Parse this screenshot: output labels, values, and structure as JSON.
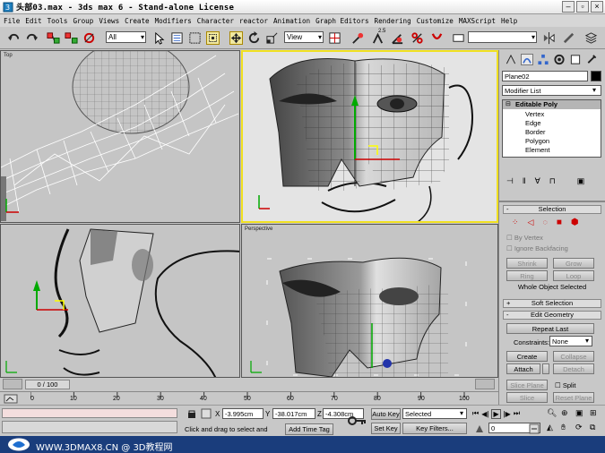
{
  "window": {
    "title": "头部03.max - 3ds max 6 - Stand-alone License"
  },
  "menu": [
    "File",
    "Edit",
    "Tools",
    "Group",
    "Views",
    "Create",
    "Modifiers",
    "Character",
    "reactor",
    "Animation",
    "Graph Editors",
    "Rendering",
    "Customize",
    "MAXScript",
    "Help"
  ],
  "toolbar": {
    "selection_filter": "All",
    "reference_coord": "View",
    "superscript": "2.5"
  },
  "viewports": {
    "top_label": "Top",
    "perspective_label": "Perspective"
  },
  "panel": {
    "object_name": "Plane02",
    "modifier_list": "Modifier List",
    "stack_root": "Editable Poly",
    "stack_items": [
      "Vertex",
      "Edge",
      "Border",
      "Polygon",
      "Element"
    ],
    "selection_title": "Selection",
    "by_vertex": "By Vertex",
    "ignore_backfacing": "Ignore Backfacing",
    "shrink": "Shrink",
    "grow": "Grow",
    "ring": "Ring",
    "loop": "Loop",
    "whole_object": "Whole Object Selected",
    "soft_selection": "Soft Selection",
    "edit_geometry": "Edit Geometry",
    "repeat_last": "Repeat Last",
    "constraints_label": "Constraints:",
    "constraints_value": "None",
    "create": "Create",
    "collapse": "Collapse",
    "attach": "Attach",
    "detach": "Detach",
    "slice_plane": "Slice Plane",
    "split": "Split",
    "slice": "Slice",
    "reset_plane": "Reset Plane",
    "rollout_minus": "-",
    "rollout_plus": "+"
  },
  "timeline": {
    "frame_counter": "0 / 100",
    "ticks": [
      "0",
      "10",
      "20",
      "30",
      "40",
      "50",
      "60",
      "70",
      "80",
      "90",
      "100"
    ]
  },
  "status": {
    "x_label": "X",
    "x": "-3.995cm",
    "y_label": "Y",
    "y": "-38.017cm",
    "z_label": "Z",
    "z": "-4.308cm",
    "prompt": "Click and drag to select and move",
    "add_time_tag": "Add Time Tag",
    "auto_key": "Auto Key",
    "set_key": "Set Key",
    "selected": "Selected",
    "key_filters": "Key Filters...",
    "frame": "0"
  },
  "footer": {
    "watermark": "WWW.3DMAX8.CN @ 3D教程网"
  },
  "colors": {
    "viewport_bg": "#c5c5c5",
    "active_border": "#f0e020",
    "footer": "#1a3d7c"
  }
}
